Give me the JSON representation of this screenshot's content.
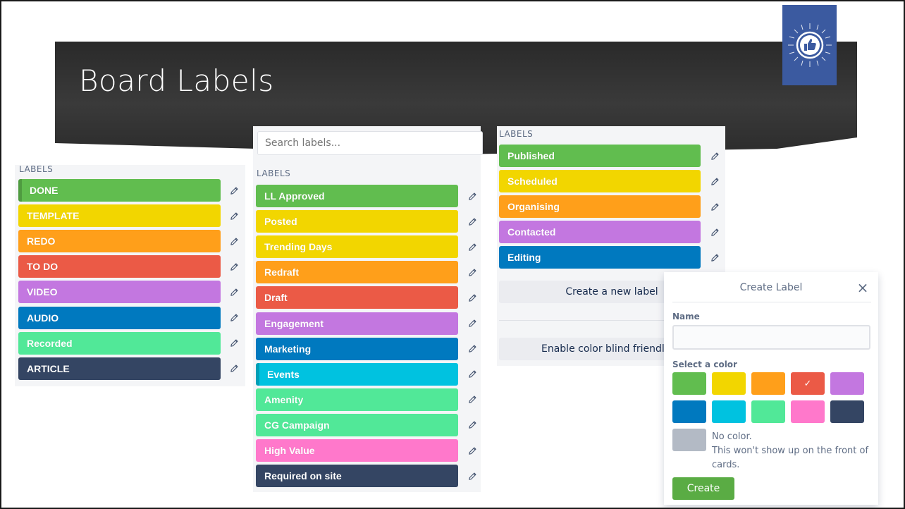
{
  "slide": {
    "title": "Board Labels"
  },
  "colors": {
    "green": "#61bd4f",
    "yellow": "#f2d600",
    "orange": "#ff9f1a",
    "red": "#eb5a46",
    "purple": "#c377e0",
    "blue": "#0079bf",
    "sky": "#00c2e0",
    "lime": "#51e898",
    "pink": "#ff78cb",
    "black": "#344563",
    "none": "#b3bac5",
    "badge": "#3b5aa0"
  },
  "panel_left": {
    "heading": "LABELS",
    "labels": [
      {
        "text": "DONE",
        "color": "#61bd4f",
        "selected": true
      },
      {
        "text": "TEMPLATE",
        "color": "#f2d600"
      },
      {
        "text": "REDO",
        "color": "#ff9f1a"
      },
      {
        "text": "TO DO",
        "color": "#eb5a46"
      },
      {
        "text": "VIDEO",
        "color": "#c377e0"
      },
      {
        "text": "AUDIO",
        "color": "#0079bf"
      },
      {
        "text": "Recorded",
        "color": "#51e898"
      },
      {
        "text": "ARTICLE",
        "color": "#344563"
      }
    ]
  },
  "panel_middle": {
    "search_placeholder": "Search labels...",
    "heading": "LABELS",
    "labels": [
      {
        "text": "LL Approved",
        "color": "#61bd4f"
      },
      {
        "text": "Posted",
        "color": "#f2d600"
      },
      {
        "text": "Trending Days",
        "color": "#f2d600"
      },
      {
        "text": "Redraft",
        "color": "#ff9f1a"
      },
      {
        "text": "Draft",
        "color": "#eb5a46"
      },
      {
        "text": "Engagement",
        "color": "#c377e0"
      },
      {
        "text": "Marketing",
        "color": "#0079bf"
      },
      {
        "text": "Events",
        "color": "#00c2e0",
        "selected": true
      },
      {
        "text": "Amenity",
        "color": "#51e898"
      },
      {
        "text": "CG Campaign",
        "color": "#51e898"
      },
      {
        "text": "High Value",
        "color": "#ff78cb"
      },
      {
        "text": "Required on site",
        "color": "#344563"
      }
    ]
  },
  "panel_right": {
    "heading": "LABELS",
    "labels": [
      {
        "text": "Published",
        "color": "#61bd4f"
      },
      {
        "text": "Scheduled",
        "color": "#f2d600"
      },
      {
        "text": "Organising",
        "color": "#ff9f1a"
      },
      {
        "text": "Contacted",
        "color": "#c377e0"
      },
      {
        "text": "Editing",
        "color": "#0079bf"
      }
    ],
    "create_new_label": "Create a new label",
    "color_blind_mode": "Enable color blind friendly m"
  },
  "create_label_popover": {
    "title": "Create Label",
    "close_glyph": "×",
    "name_label": "Name",
    "name_value": "",
    "select_color_label": "Select a color",
    "swatches": [
      {
        "color": "#61bd4f"
      },
      {
        "color": "#f2d600"
      },
      {
        "color": "#ff9f1a"
      },
      {
        "color": "#eb5a46",
        "selected": true
      },
      {
        "color": "#c377e0"
      },
      {
        "color": "#0079bf"
      },
      {
        "color": "#00c2e0"
      },
      {
        "color": "#51e898"
      },
      {
        "color": "#ff78cb"
      },
      {
        "color": "#344563"
      }
    ],
    "check_glyph": "✓",
    "no_color_title": "No color.",
    "no_color_desc": "This won't show up on the front of cards.",
    "create_button": "Create"
  }
}
